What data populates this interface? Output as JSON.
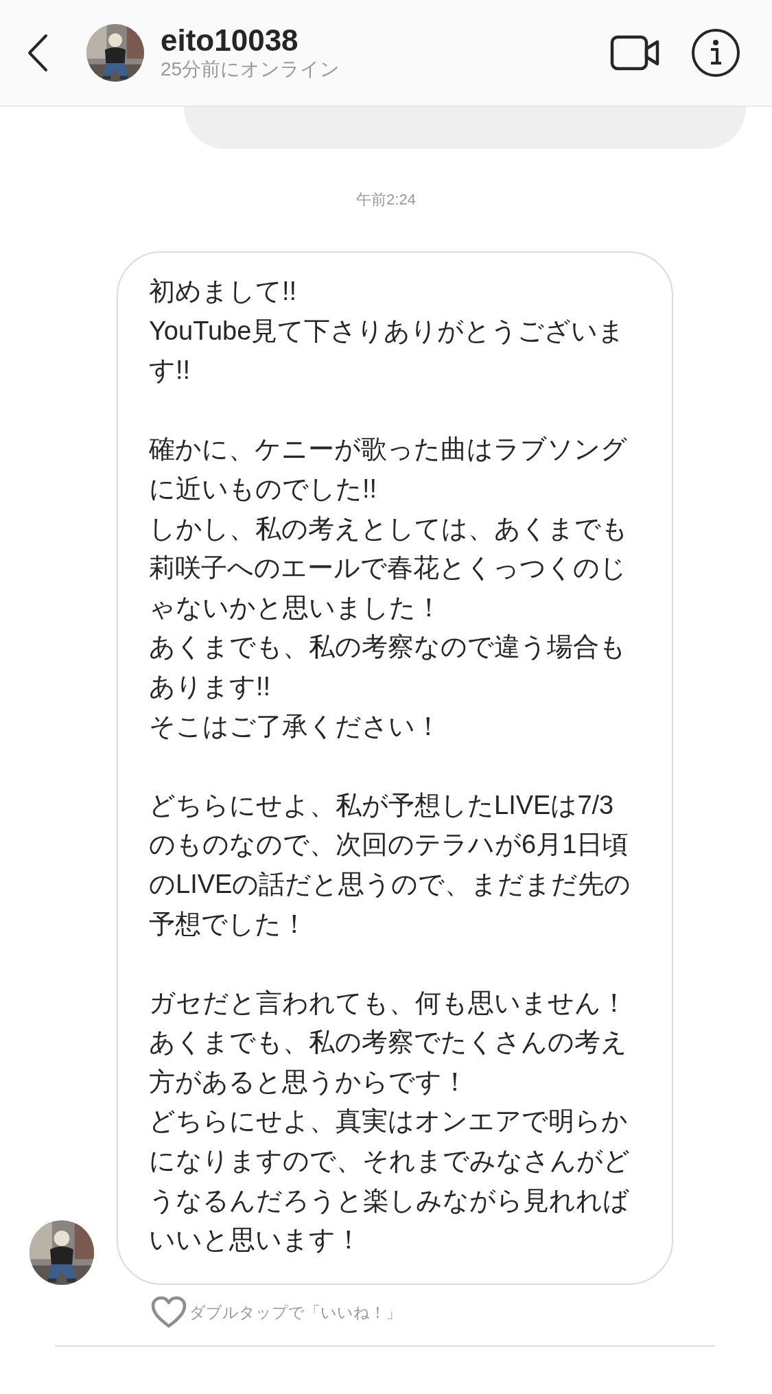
{
  "header": {
    "username": "eito10038",
    "status": "25分前にオンライン"
  },
  "thread": [
    {
      "kind": "sent"
    },
    {
      "kind": "time",
      "text": "午前2:24"
    },
    {
      "kind": "received",
      "paragraphs": [
        [
          "初めまして!!",
          "YouTube見て下さりありがとうございます!!"
        ],
        [
          "確かに、ケニーが歌った曲はラブソングに近いものでした!!",
          "しかし、私の考えとしては、あくまでも莉咲子へのエールで春花とくっつくのじゃないかと思いました！",
          "あくまでも、私の考察なので違う場合もあります!!",
          "そこはご了承ください！"
        ],
        [
          "どちらにせよ、私が予想したLIVEは7/3のものなので、次回のテラハが6月1日頃のLIVEの話だと思うので、まだまだ先の予想でした！"
        ],
        [
          "ガセだと言われても、何も思いません！",
          "あくまでも、私の考察でたくさんの考え方があると思うからです！",
          "どちらにせよ、真実はオンエアで明らかになりますので、それまでみなさんがどうなるんだろうと楽しみながら見れればいいと思います！"
        ]
      ],
      "like_hint": "ダブルタップで「いいね！」"
    }
  ]
}
